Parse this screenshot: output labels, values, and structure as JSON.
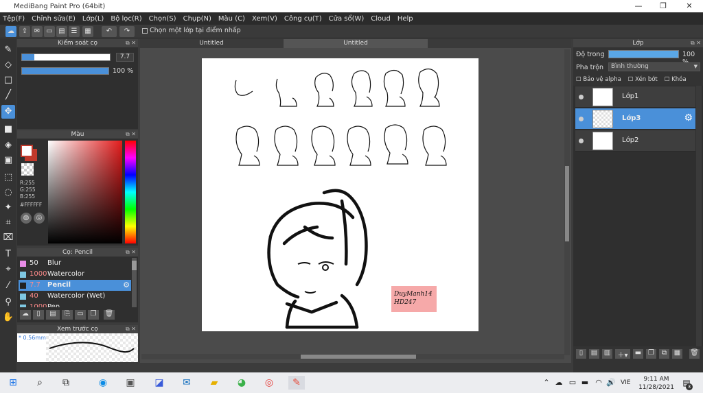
{
  "window": {
    "title": "MediBang Paint Pro (64bit)"
  },
  "menu": [
    "Tệp(F)",
    "Chỉnh sửa(E)",
    "Lớp(L)",
    "Bộ lọc(R)",
    "Chọn(S)",
    "Chụp(N)",
    "Màu (C)",
    "Xem(V)",
    "Công cụ(T)",
    "Cửa sổ(W)",
    "Cloud",
    "Help"
  ],
  "toolbar": {
    "select_layer_on_click": "Chọn một lớp tại điểm nhấp"
  },
  "brush_control": {
    "title": "Kiểm soát cọ",
    "size_value": "7.7",
    "opacity_value": "100 %",
    "opacity_fraction": 1.0
  },
  "color_panel": {
    "title": "Màu",
    "r": "R:255",
    "g": "G:255",
    "b": "B:255",
    "hex": "#FFFFFF"
  },
  "brush_panel": {
    "title": "Cọ: Pencil",
    "items": [
      {
        "size": "50",
        "name": "Blur",
        "color": "#e88ce6"
      },
      {
        "size": "1000",
        "name": "Watercolor",
        "color": "#7ec8e3"
      },
      {
        "size": "7.7",
        "name": "Pencil",
        "color": "#222222"
      },
      {
        "size": "40",
        "name": "Watercolor (Wet)",
        "color": "#7ec8e3"
      },
      {
        "size": "1000",
        "name": "Pen",
        "color": "#7ec8e3"
      }
    ]
  },
  "preview_panel": {
    "title": "Xem trước cọ",
    "size": "* 0.56mm"
  },
  "tabs": [
    "Untitled",
    "Untitled"
  ],
  "layers_panel": {
    "title": "Lớp",
    "opacity_label": "Độ trong",
    "opacity_value": "100 %",
    "blend_label": "Pha trộn",
    "blend_value": "Bình thường",
    "protect_alpha": "Bảo vệ alpha",
    "clipping": "Xén bớt",
    "lock": "Khóa",
    "layers": [
      {
        "name": "Lớp1"
      },
      {
        "name": "Lớp3"
      },
      {
        "name": "Lớp2"
      }
    ]
  },
  "canvas": {
    "signature_text": "DuyManh14 HD247"
  },
  "taskbar": {
    "time": "9:11 AM",
    "date": "11/28/2021",
    "lang": "VIE",
    "notifications": "3"
  },
  "colors": {
    "accent": "#4a90d9",
    "panel": "#2f2f2f",
    "signature_bg": "#f6a9a9"
  }
}
